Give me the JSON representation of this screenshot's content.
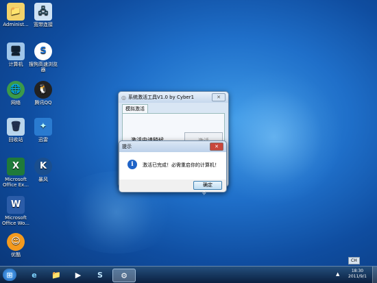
{
  "desktop": {
    "icons": [
      {
        "label": "Administ...",
        "glyph": "📁"
      },
      {
        "label": "宽带连接",
        "glyph": "🖧"
      },
      {
        "label": "计算机",
        "glyph": "🖥"
      },
      {
        "label": "搜狗高速浏览器",
        "glyph": "S"
      },
      {
        "label": "网络",
        "glyph": "🌐"
      },
      {
        "label": "腾讯QQ",
        "glyph": "🐧"
      },
      {
        "label": "回收站",
        "glyph": "🗑"
      },
      {
        "label": "迅雷",
        "glyph": "✦"
      },
      {
        "label": "Microsoft Office Ex...",
        "glyph": "X"
      },
      {
        "label": "暴风",
        "glyph": "K"
      },
      {
        "label": "Microsoft Office Wo...",
        "glyph": "W"
      },
      {
        "label": "优酷",
        "glyph": "☺"
      }
    ]
  },
  "main_window": {
    "title": "系统激活工具V1.0 by Cyber1",
    "tab": "模拟激活",
    "status": "激活中请稍候",
    "activate_button": "激活"
  },
  "dialog": {
    "title": "提示",
    "message": "激活已完成！必需重启你的计算机！",
    "ok_button": "确定",
    "info_icon": "i"
  },
  "taskbar": {
    "lang": "CH",
    "time": "18:30",
    "date": "2011/9/1"
  }
}
